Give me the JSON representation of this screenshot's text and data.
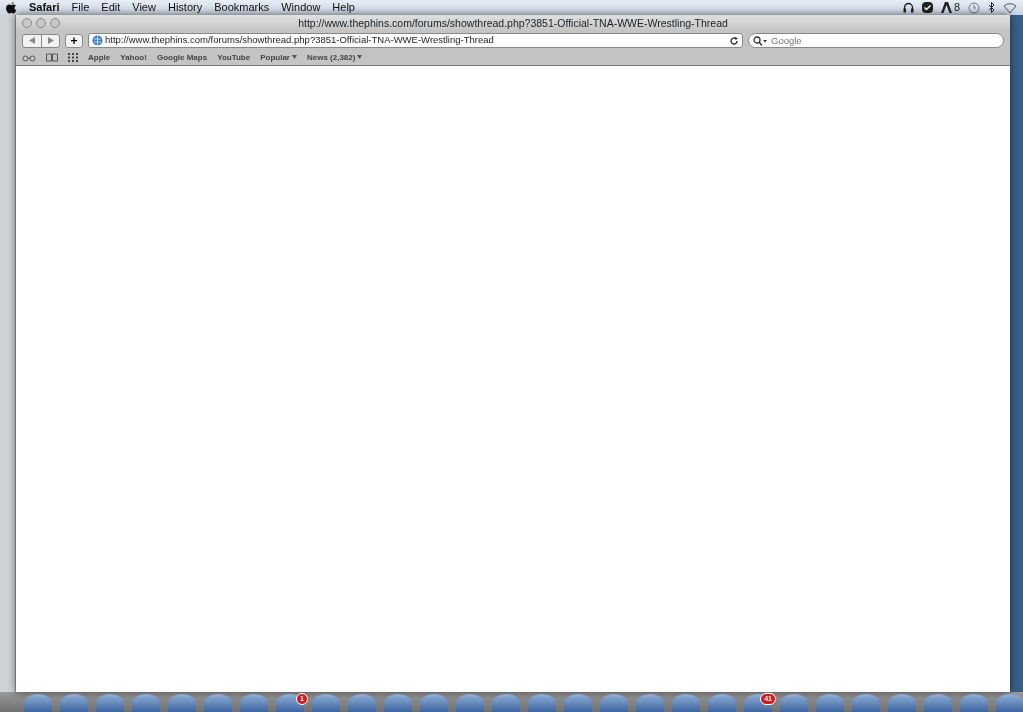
{
  "menu_bar": {
    "app": "Safari",
    "items": [
      "File",
      "Edit",
      "View",
      "History",
      "Bookmarks",
      "Window",
      "Help"
    ],
    "status_count": "8"
  },
  "window": {
    "title": "http://www.thephins.com/forums/showthread.php?3851-Official-TNA-WWE-Wrestling-Thread"
  },
  "toolbar": {
    "add_label": "+",
    "address": "http://www.thephins.com/forums/showthread.php?3851-Official-TNA-WWE-Wrestling-Thread",
    "search_placeholder": "Google"
  },
  "bookmarks": [
    {
      "label": "Apple",
      "menu": false
    },
    {
      "label": "Yahoo!",
      "menu": false
    },
    {
      "label": "Google Maps",
      "menu": false
    },
    {
      "label": "YouTube",
      "menu": false
    },
    {
      "label": "Popular",
      "menu": true
    },
    {
      "label": "News (2,382)",
      "menu": true
    }
  ],
  "dock": {
    "badges": [
      "1",
      "41"
    ]
  }
}
